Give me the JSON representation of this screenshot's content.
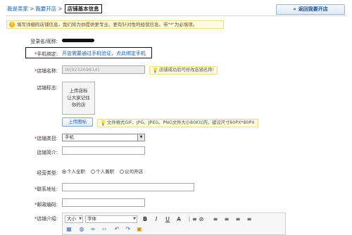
{
  "breadcrumb": {
    "seller": "我是卖家",
    "open_store": "我要开店",
    "current": "店铺基本信息",
    "separator": ">"
  },
  "back_button": {
    "label": "返回我要开店",
    "icon": "double-chevron-left-icon"
  },
  "notice": {
    "icon": "info-icon",
    "text": "填写详细的店铺信息，我们将为你提供更专业、更有针对性的经营信息。带\"*\"为必填项。"
  },
  "form": {
    "login_name_label": "登录名/昵称:",
    "phone_bind_label": "手机绑定:",
    "phone_bind_link": "开店需要通过手机验证，点此绑定手机",
    "store_name_label": "店铺名称:",
    "store_name_value": "tb[923269614]",
    "store_name_tip": "店铺成功后可修改店铺名称!",
    "store_logo_label": "店铺标志:",
    "logo_placeholder": [
      "上传店标",
      "让大家记住",
      "你的店"
    ],
    "upload_button": "上传图标",
    "logo_tip": "文件格式GIF、JPG、JPEG、PNG文件大小80K以内，建议尺寸80PX*80PX",
    "category_label": "店铺类目:",
    "category_value": "手机",
    "intro_label": "店铺简介:",
    "business_type_label": "经营类型:",
    "business_options": [
      {
        "label": "个人全职",
        "selected": true
      },
      {
        "label": "个人兼职",
        "selected": false
      },
      {
        "label": "公司开店",
        "selected": false
      }
    ],
    "address_label": "联系地址:",
    "zip_label": "邮政编码:",
    "store_intro_label": "店铺介绍:",
    "required_mark": "*"
  },
  "editor": {
    "size_select": "大小",
    "font_select": "字体",
    "dropdown_glyph": "▼",
    "buttons": [
      "B",
      "I",
      "U",
      "A̶",
      "⋮≡",
      "⊘",
      "≡",
      "≡",
      "≡",
      "≡"
    ]
  },
  "colors": {
    "link": "#1a5fb4",
    "required": "#d40000",
    "notice_bg": "#fffbe3"
  }
}
